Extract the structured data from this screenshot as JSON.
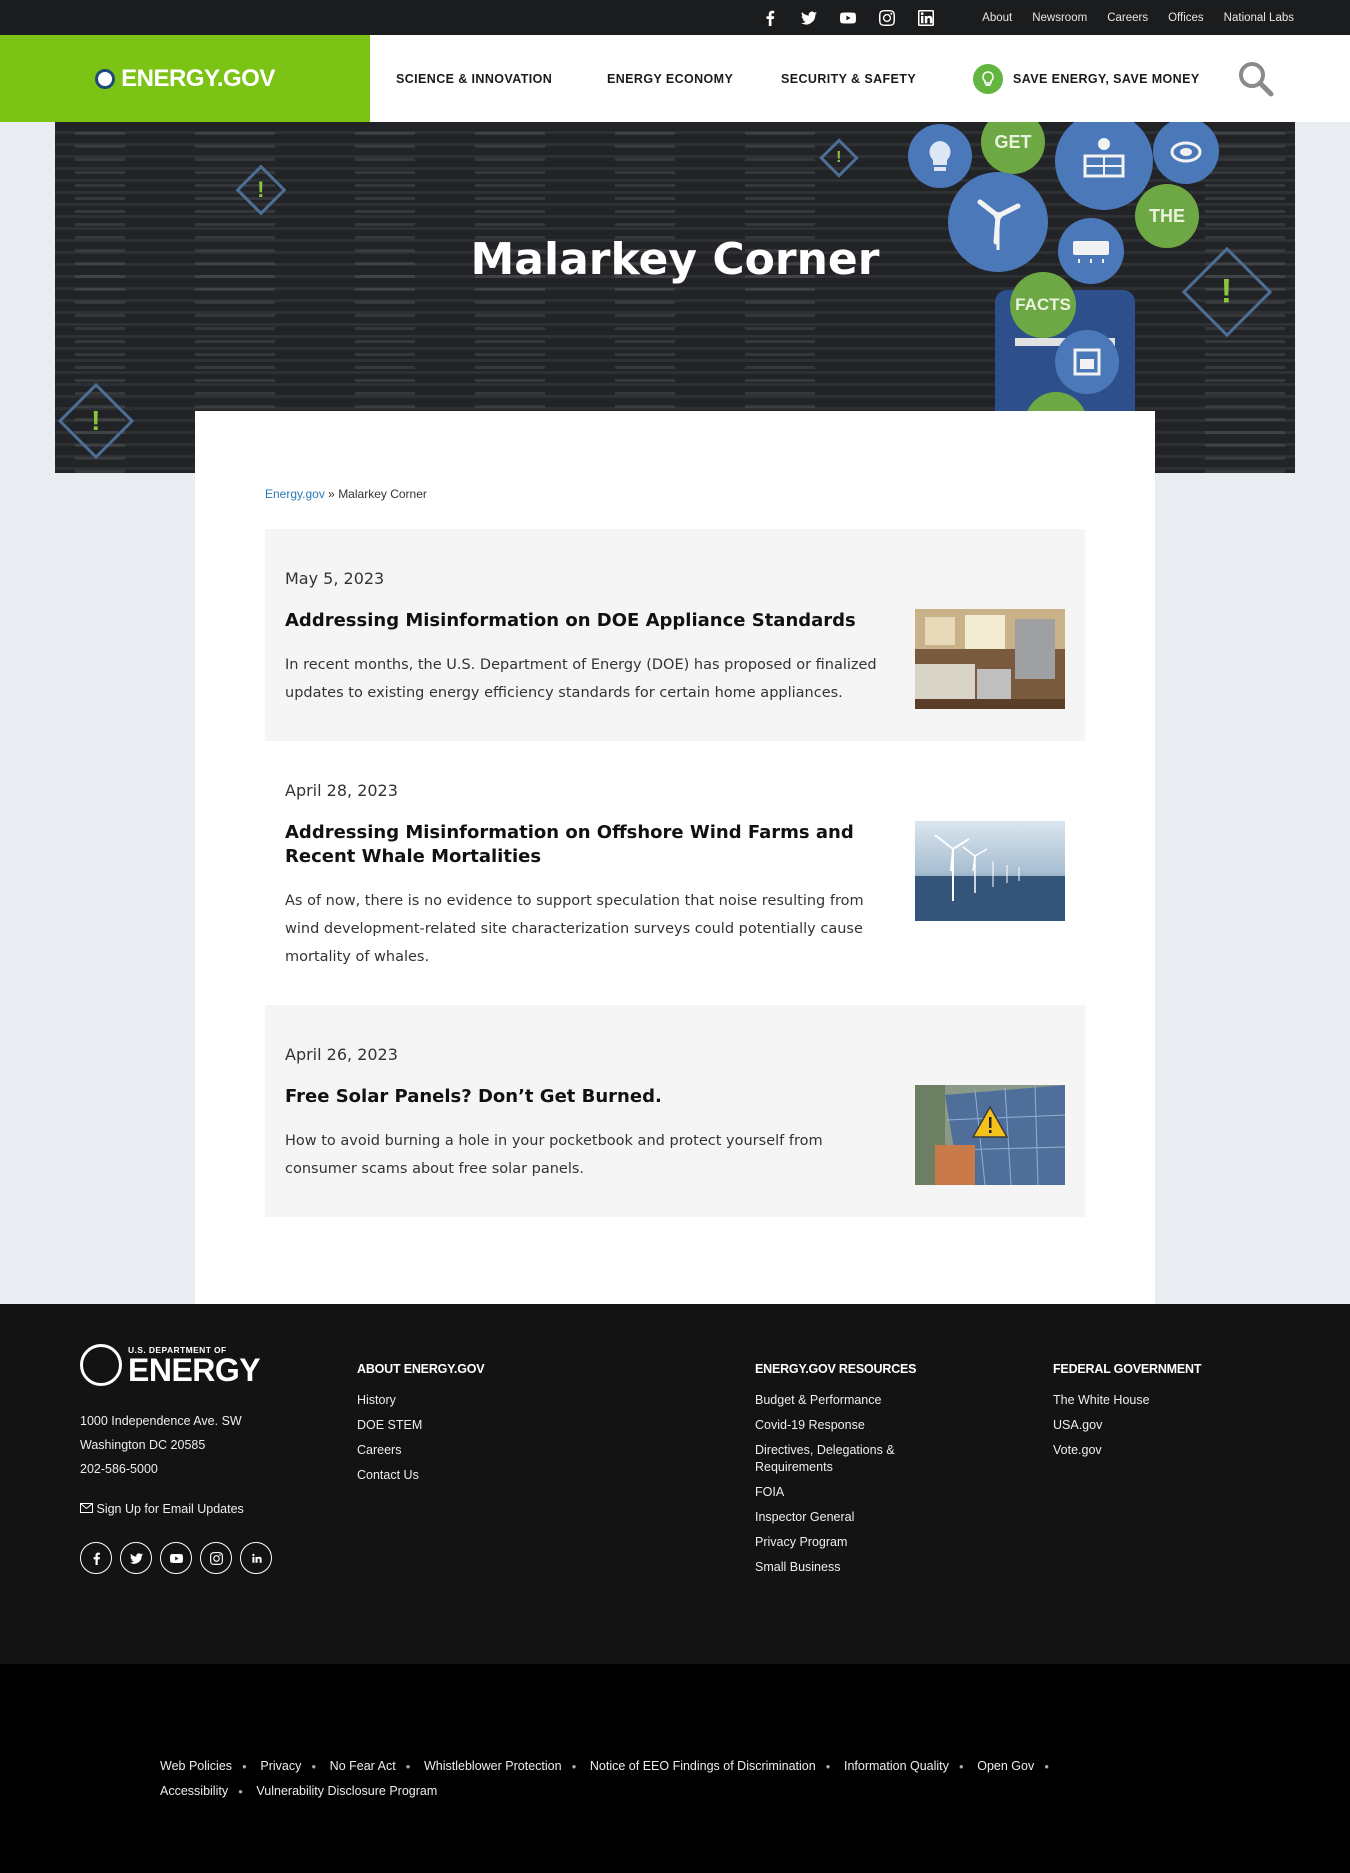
{
  "utility": {
    "links": [
      "About",
      "Newsroom",
      "Careers",
      "Offices",
      "National Labs"
    ]
  },
  "header": {
    "brand": "ENERGY.GOV",
    "nav": [
      "SCIENCE & INNOVATION",
      "ENERGY ECONOMY",
      "SECURITY & SAFETY",
      "SAVE ENERGY, SAVE MONEY"
    ]
  },
  "hero": {
    "title": "Malarkey Corner",
    "bubbles": [
      "GET",
      "THE",
      "FACTS"
    ]
  },
  "breadcrumb": {
    "home": "Energy.gov",
    "separator": "»",
    "current": "Malarkey Corner"
  },
  "articles": [
    {
      "date": "May 5, 2023",
      "title": "Addressing Misinformation on DOE Appliance Standards",
      "description": "In recent months, the U.S. Department of Energy (DOE) has proposed or finalized updates to existing energy efficiency standards for certain home appliances."
    },
    {
      "date": "April 28, 2023",
      "title": "Addressing Misinformation on Offshore Wind Farms and Recent Whale Mortalities",
      "description": "As of now, there is no evidence to support speculation that noise resulting from wind development-related site characterization surveys could potentially cause mortality of whales."
    },
    {
      "date": "April 26, 2023",
      "title": "Free Solar Panels? Don’t Get Burned.",
      "description": "How to avoid burning a hole in your pocketbook and protect yourself from consumer scams about free solar panels."
    }
  ],
  "footer": {
    "logo_small": "U.S. DEPARTMENT OF",
    "logo_large": "ENERGY",
    "address": [
      "1000 Independence Ave. SW",
      "Washington DC 20585",
      "202-586-5000"
    ],
    "email_updates": "Sign Up for Email Updates",
    "about": {
      "heading": "ABOUT ENERGY.GOV",
      "links": [
        "History",
        "DOE STEM",
        "Careers",
        "Contact Us"
      ]
    },
    "resources": {
      "heading": "ENERGY.GOV RESOURCES",
      "links": [
        "Budget & Performance",
        "Covid-19 Response",
        "Directives, Delegations & Requirements",
        "FOIA",
        "Inspector General",
        "Privacy Program",
        "Small Business"
      ]
    },
    "federal": {
      "heading": "FEDERAL GOVERNMENT",
      "links": [
        "The White House",
        "USA.gov",
        "Vote.gov"
      ]
    }
  },
  "legal": {
    "row1": [
      "Web Policies",
      "Privacy",
      "No Fear Act",
      "Whistleblower Protection",
      "Notice of EEO Findings of Discrimination",
      "Information Quality",
      "Open Gov"
    ],
    "row2": [
      "Accessibility",
      "Vulnerability Disclosure Program"
    ]
  },
  "colors": {
    "brand_green": "#7bc314",
    "link_blue": "#2a7ab8",
    "footer_bg": "#131313",
    "legal_bg": "#000000"
  }
}
